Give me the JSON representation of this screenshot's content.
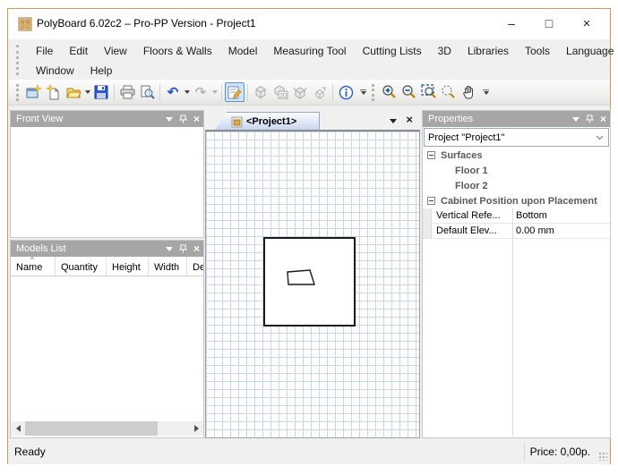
{
  "window": {
    "title": "PolyBoard 6.02c2 – Pro-PP Version - Project1",
    "controls": {
      "minimize": "–",
      "maximize": "□",
      "close": "×"
    }
  },
  "menu": {
    "row1": [
      "File",
      "Edit",
      "View",
      "Floors & Walls",
      "Model",
      "Measuring Tool",
      "Cutting Lists",
      "3D",
      "Libraries",
      "Tools",
      "Language"
    ],
    "row2": [
      "Window",
      "Help"
    ]
  },
  "toolbar": {
    "icons": [
      "new-project",
      "new-model",
      "open",
      "open-dropdown",
      "save",
      "print",
      "print-preview",
      "undo",
      "undo-dropdown",
      "redo",
      "redo-dropdown",
      "properties",
      "render-3d",
      "view-2d-3d",
      "open-3d",
      "export-3d",
      "info",
      "toolbar-options",
      "zoom-in",
      "zoom-out",
      "zoom-window",
      "zoom-dynamic",
      "pan",
      "toolbar-options-2"
    ],
    "undo_glyph": "↶",
    "redo_glyph": "↷"
  },
  "front_view": {
    "title": "Front View"
  },
  "models_list": {
    "title": "Models List",
    "columns": [
      "Name",
      "Quantity",
      "Height",
      "Width",
      "Dep"
    ],
    "sort_indicator": "^",
    "rows": []
  },
  "canvas": {
    "tab": {
      "label": "<Project1>"
    },
    "shapes": [
      "room-outline-square",
      "cabinet-plan-trapezoid"
    ]
  },
  "properties": {
    "title": "Properties",
    "selector": "Project \"Project1\"",
    "groups": [
      {
        "label": "Surfaces",
        "children": [
          "Floor 1",
          "Floor 2"
        ]
      },
      {
        "label": "Cabinet Position upon Placement",
        "rows": [
          {
            "name": "Vertical Refe...",
            "value": "Bottom"
          },
          {
            "name": "Default Elev...",
            "value": "0.00 mm"
          }
        ]
      }
    ]
  },
  "status_bar": {
    "ready": "Ready",
    "price": "Price: 0,00p."
  },
  "colors": {
    "window_border": "#d79b45",
    "panel_header": "#a6a6a6",
    "grid_line": "#c9d6ea",
    "tab_gradient_bottom": "#c6d3ee",
    "toolbar_selected_border": "#5e93d1",
    "toolbar_selected_bg": "#cfe4fc"
  }
}
